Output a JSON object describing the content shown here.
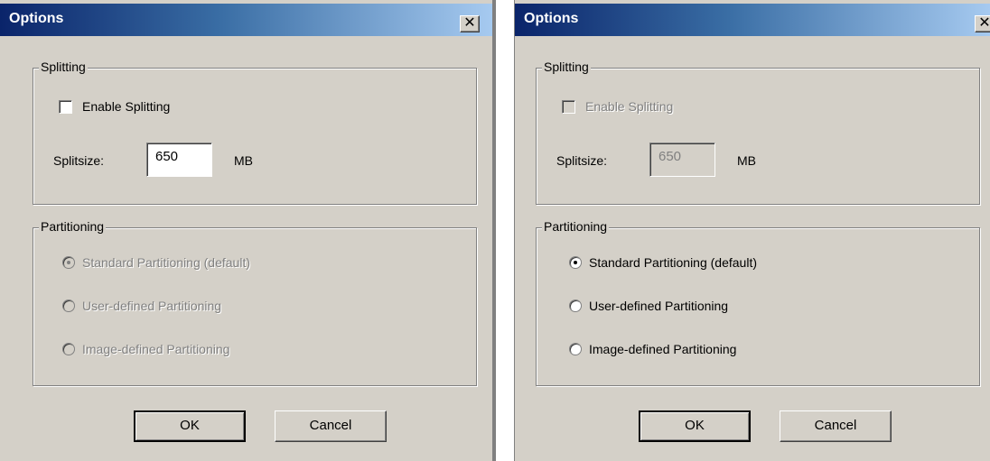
{
  "dialogs": [
    {
      "title": "Options",
      "close_glyph": "✕",
      "splitting": {
        "legend": "Splitting",
        "enable_label": "Enable Splitting",
        "enable_checked": false,
        "enabled": true,
        "splitsize_label": "Splitsize:",
        "splitsize_value": "650",
        "unit": "MB"
      },
      "partitioning": {
        "legend": "Partitioning",
        "enabled": false,
        "options": [
          "Standard Partitioning (default)",
          "User-defined Partitioning",
          "Image-defined Partitioning"
        ],
        "selected_index": 0
      },
      "buttons": {
        "ok": "OK",
        "cancel": "Cancel"
      }
    },
    {
      "title": "Options",
      "close_glyph": "✕",
      "splitting": {
        "legend": "Splitting",
        "enable_label": "Enable Splitting",
        "enable_checked": false,
        "enabled": false,
        "splitsize_label": "Splitsize:",
        "splitsize_value": "650",
        "unit": "MB"
      },
      "partitioning": {
        "legend": "Partitioning",
        "enabled": true,
        "options": [
          "Standard Partitioning (default)",
          "User-defined Partitioning",
          "Image-defined Partitioning"
        ],
        "selected_index": 0
      },
      "buttons": {
        "ok": "OK",
        "cancel": "Cancel"
      }
    }
  ]
}
